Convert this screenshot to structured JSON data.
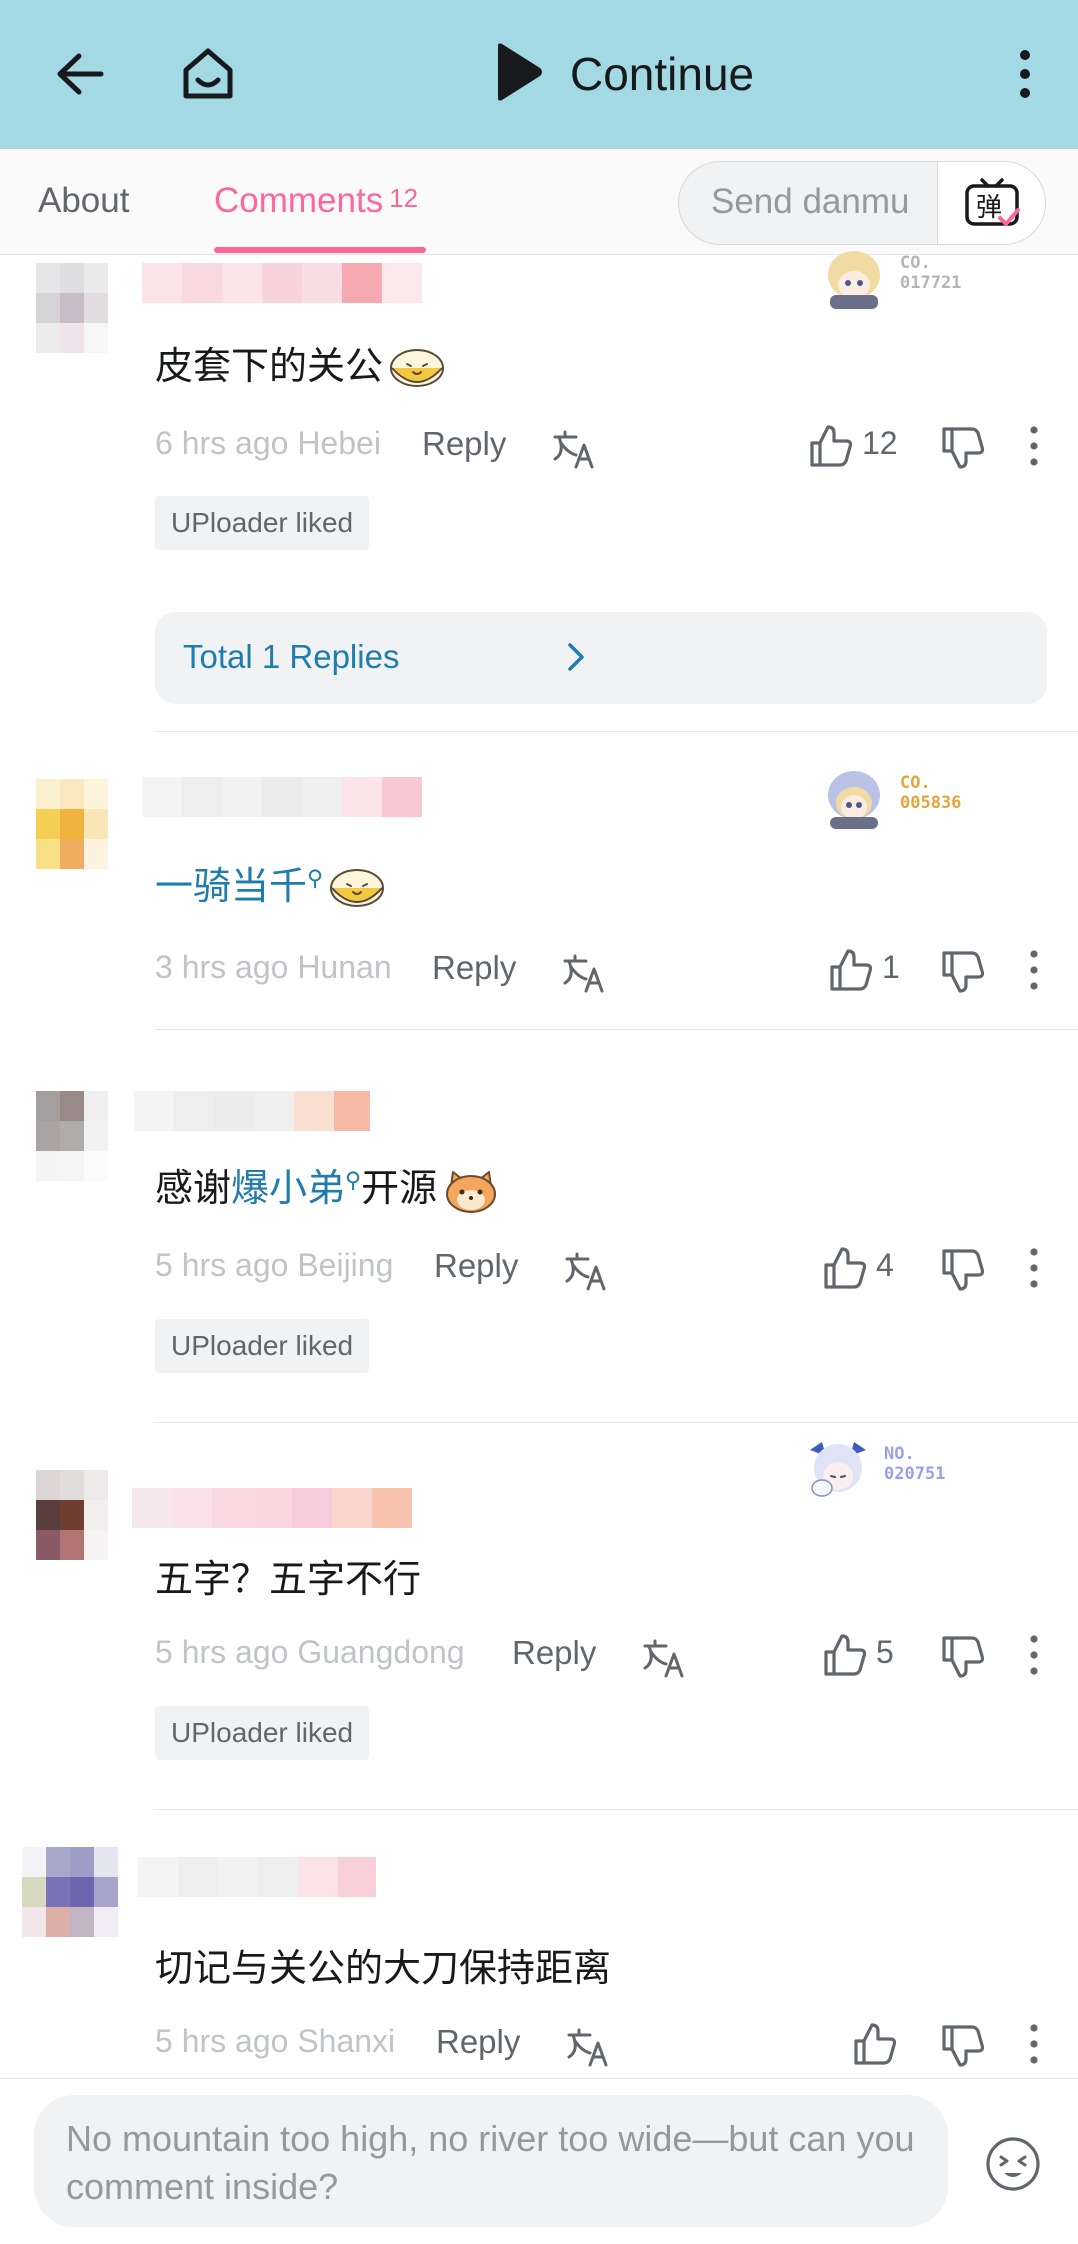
{
  "topbar": {
    "continue_label": "Continue"
  },
  "tabs": {
    "about": "About",
    "comments": "Comments",
    "comments_count": "12"
  },
  "danmu": {
    "placeholder": "Send danmu",
    "button_glyph": "弹"
  },
  "comments": [
    {
      "text": "皮套下的关公",
      "time": "6 hrs ago",
      "location": "Hebei",
      "reply_label": "Reply",
      "likes": "12",
      "badge_number": "CO.\n017721",
      "badge_color": "#b5b5b5",
      "uploader_liked": "UPloader liked",
      "replies_label": "Total 1 Replies"
    },
    {
      "text_link": "一骑当千",
      "time": "3 hrs ago",
      "location": "Hunan",
      "reply_label": "Reply",
      "likes": "1",
      "badge_number": "CO.\n005836",
      "badge_color": "#e5a53a"
    },
    {
      "text_prefix": "感谢",
      "text_link": "爆小弟",
      "text_suffix": "开源",
      "time": "5 hrs ago",
      "location": "Beijing",
      "reply_label": "Reply",
      "likes": "4",
      "uploader_liked": "UPloader liked"
    },
    {
      "text": "五字？五字不行",
      "time": "5 hrs ago",
      "location": "Guangdong",
      "reply_label": "Reply",
      "likes": "5",
      "badge_number": "NO.\n020751",
      "badge_color": "#9aa0e8",
      "uploader_liked": "UPloader liked"
    },
    {
      "text": "切记与关公的大刀保持距离",
      "time": "5 hrs ago",
      "location": "Shanxi",
      "reply_label": "Reply",
      "likes": ""
    }
  ],
  "input": {
    "placeholder": "No mountain too high, no river too wide—but can you comment inside?"
  },
  "icons": [
    "back-arrow-icon",
    "home-tv-icon",
    "play-icon",
    "more-vertical-icon",
    "danmu-icon",
    "translate-icon",
    "thumb-up-icon",
    "thumb-down-icon",
    "emoji-icon"
  ],
  "colors": {
    "topbar": "#a3d9e3",
    "accent": "#ff6699",
    "link": "#1e7dac"
  }
}
